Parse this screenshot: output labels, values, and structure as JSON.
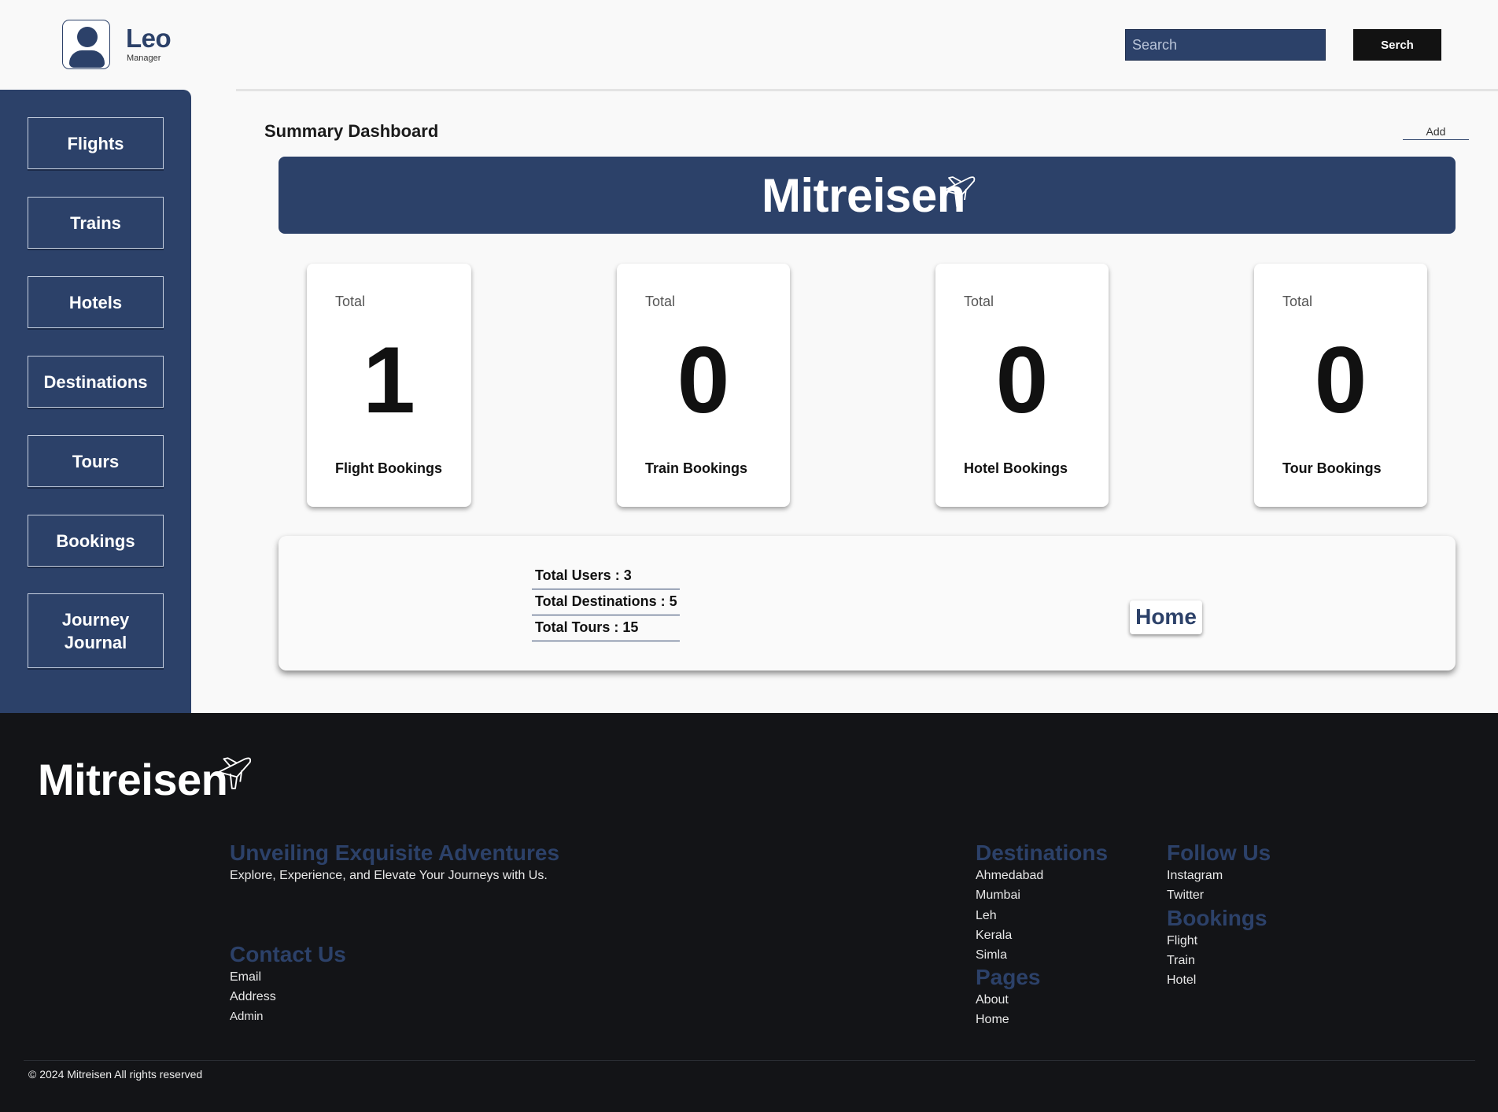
{
  "header": {
    "user_name": "Leo",
    "user_role": "Manager",
    "search_placeholder": "Search",
    "search_button": "Serch"
  },
  "sidebar": {
    "items": [
      {
        "label": "Flights"
      },
      {
        "label": "Trains"
      },
      {
        "label": "Hotels"
      },
      {
        "label": "Destinations"
      },
      {
        "label": "Tours"
      },
      {
        "label": "Bookings"
      },
      {
        "label": "Journey Journal"
      }
    ]
  },
  "main": {
    "title": "Summary Dashboard",
    "add_label": "Add",
    "brand": "Mitreisen",
    "stats": [
      {
        "total_label": "Total",
        "value": "1",
        "label": "Flight Bookings"
      },
      {
        "total_label": "Total",
        "value": "0",
        "label": "Train Bookings"
      },
      {
        "total_label": "Total",
        "value": "0",
        "label": "Hotel Bookings"
      },
      {
        "total_label": "Total",
        "value": "0",
        "label": "Tour Bookings"
      }
    ],
    "summary": {
      "users": "Total Users : 3",
      "destinations": "Total Destinations : 5",
      "tours": "Total Tours : 15",
      "home_button": "Home"
    }
  },
  "footer": {
    "brand": "Mitreisen",
    "tagline_heading": "Unveiling Exquisite Adventures",
    "tagline_text": "Explore, Experience, and Elevate Your Journeys with Us.",
    "contact": {
      "heading": "Contact Us",
      "links": [
        "Email",
        "Address",
        "Admin"
      ]
    },
    "destinations": {
      "heading": "Destinations",
      "links": [
        "Ahmedabad",
        "Mumbai",
        "Leh",
        "Kerala",
        "Simla"
      ]
    },
    "pages": {
      "heading": "Pages",
      "links": [
        "About",
        "Home"
      ]
    },
    "follow": {
      "heading": "Follow Us",
      "links": [
        "Instagram",
        "Twitter"
      ]
    },
    "bookings": {
      "heading": "Bookings",
      "links": [
        "Flight",
        "Train",
        "Hotel"
      ]
    },
    "copyright": "© 2024 Mitreisen All rights reserved"
  },
  "colors": {
    "primary": "#2c4169",
    "footer_bg": "#131417",
    "page_bg": "#f9f9f9"
  },
  "icons": [
    "user-icon",
    "plane-icon"
  ]
}
